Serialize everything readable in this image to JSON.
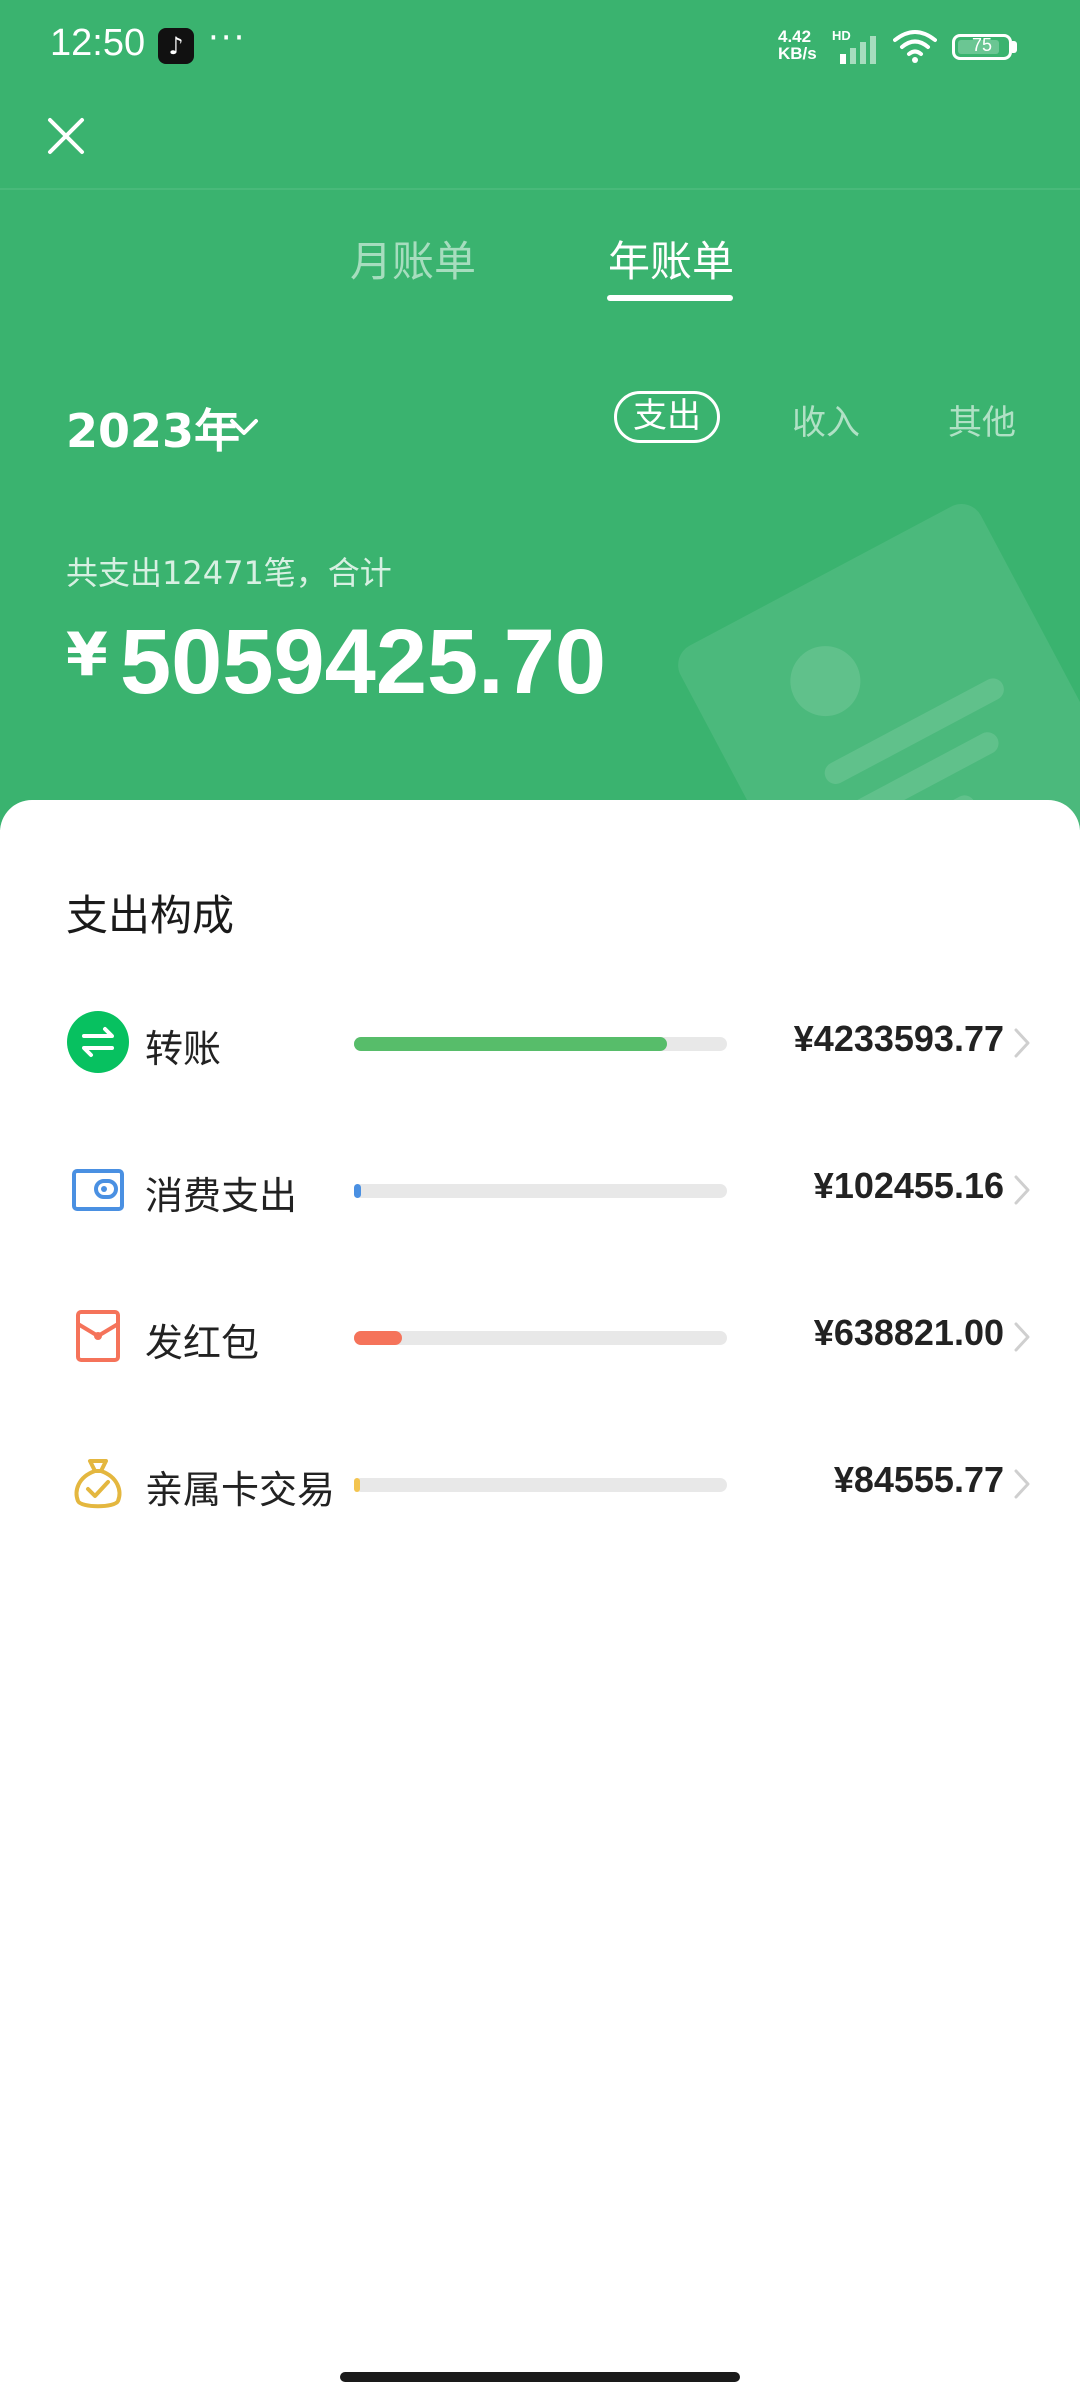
{
  "status_bar": {
    "time": "12:50",
    "more": "···",
    "net_speed_value": "4.42",
    "net_speed_unit": "KB/s",
    "network_badge": "HD",
    "battery": "75"
  },
  "tabs": [
    {
      "label": "月账单",
      "active": false
    },
    {
      "label": "年账单",
      "active": true
    }
  ],
  "year_selector": "2023年",
  "type_filters": [
    {
      "label": "支出",
      "active": true
    },
    {
      "label": "收入",
      "active": false
    },
    {
      "label": "其他",
      "active": false
    }
  ],
  "summary_text": "共支出12471笔，合计",
  "total": {
    "currency": "¥",
    "amount": "5059425.70"
  },
  "breakdown": {
    "title": "支出构成",
    "items": [
      {
        "label": "转账",
        "icon": "transfer-icon",
        "amount": "¥4233593.77",
        "ratio": 0.84,
        "color": "#57bd6a"
      },
      {
        "label": "消费支出",
        "icon": "wallet-icon",
        "amount": "¥102455.16",
        "ratio": 0.02,
        "color": "#4a90e2"
      },
      {
        "label": "发红包",
        "icon": "red-packet-icon",
        "amount": "¥638821.00",
        "ratio": 0.13,
        "color": "#f5735a"
      },
      {
        "label": "亲属卡交易",
        "icon": "money-bag-icon",
        "amount": "¥84555.77",
        "ratio": 0.017,
        "color": "#f3c44f"
      }
    ]
  },
  "colors": {
    "header_bg": "#3ab36f",
    "transfer": "#07c160",
    "consumption": "#4a90e2",
    "red_packet": "#f5735a",
    "family_card": "#e4b73f"
  }
}
